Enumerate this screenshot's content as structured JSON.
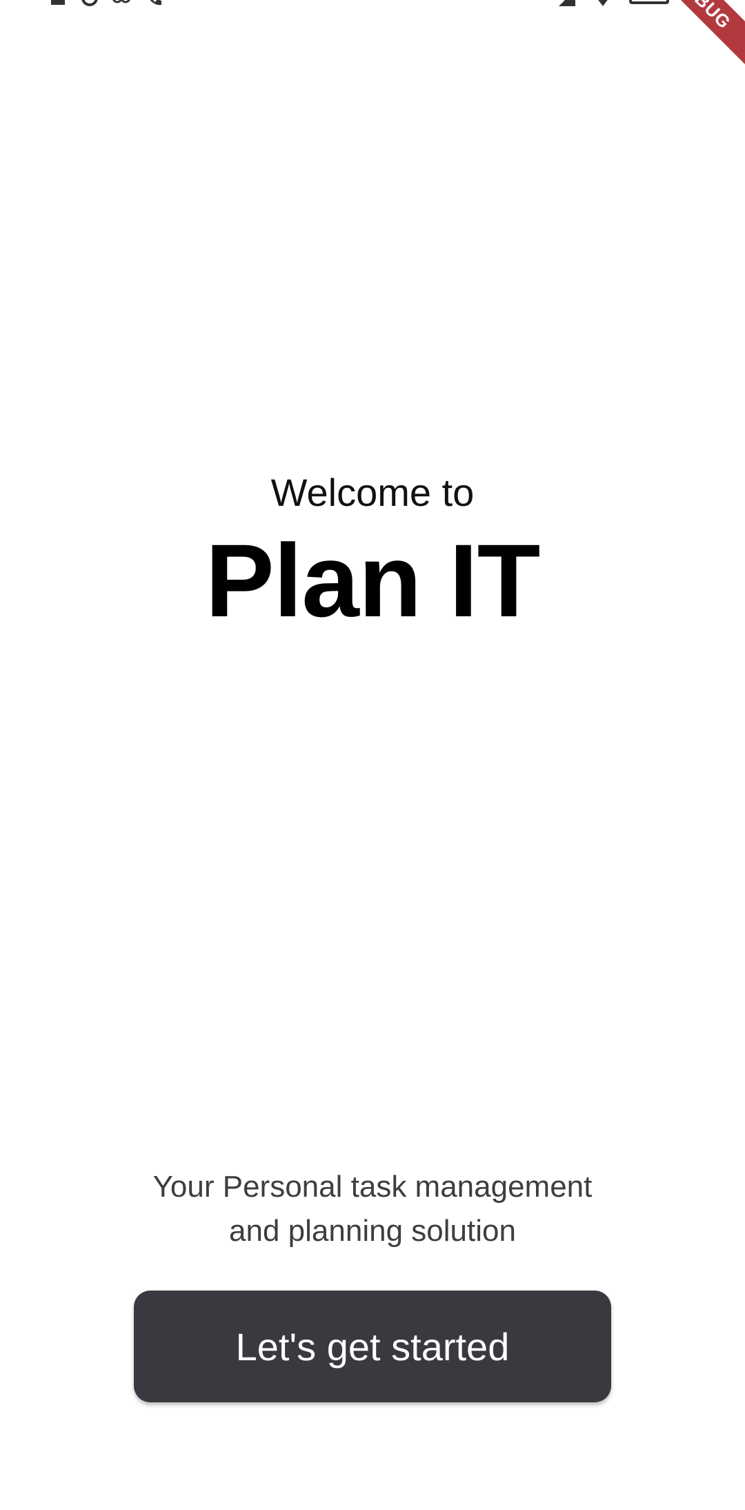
{
  "debug_banner": {
    "label": "DEBUG",
    "color": "#b23a3f"
  },
  "status_bar": {
    "icons_left": [
      "notification-icon",
      "alarm-icon",
      "voicemail-icon",
      "call-icon"
    ],
    "icons_right": [
      "signal-icon",
      "wifi-icon",
      "battery-icon"
    ]
  },
  "welcome": {
    "subtitle": "Welcome to",
    "title": "Plan IT"
  },
  "tagline": {
    "line1": "Your Personal task management",
    "line2": "and planning solution"
  },
  "cta": {
    "label": "Let's get started",
    "background": "#3b383f",
    "text_color": "#ffffff"
  }
}
